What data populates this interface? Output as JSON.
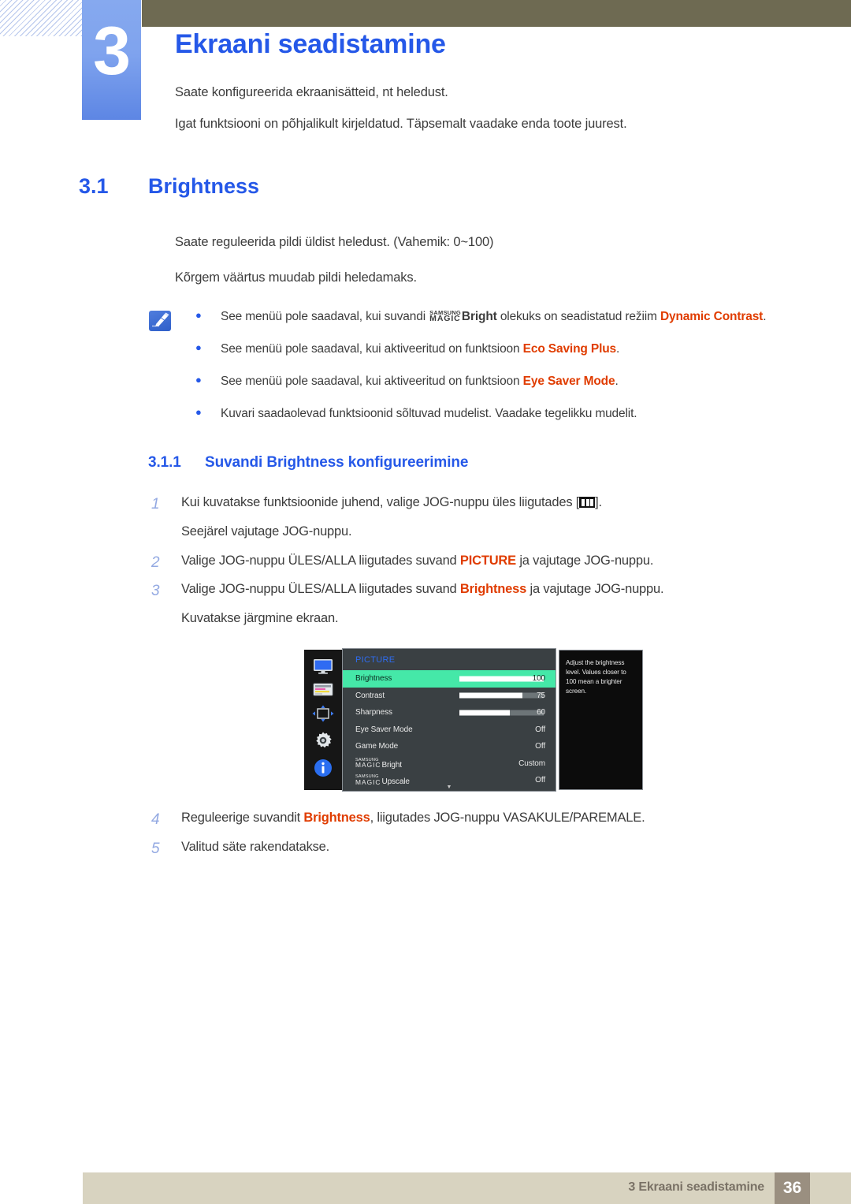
{
  "header": {
    "chapter_number": "3",
    "chapter_title": "Ekraani seadistamine",
    "intro_line_1": "Saate konfigureerida ekraanisätteid, nt heledust.",
    "intro_line_2": "Igat funktsiooni on põhjalikult kirjeldatud. Täpsemalt vaadake enda toote juurest.",
    "accent_color": "#2558e8",
    "band_color": "#6e6a52"
  },
  "section": {
    "number": "3.1",
    "title": "Brightness",
    "paragraph_1": "Saate reguleerida pildi üldist heledust. (Vahemik: 0~100)",
    "paragraph_2": "Kõrgem väärtus muudab pildi heledamaks."
  },
  "notes": {
    "icon": "note-pencil-icon",
    "items": [
      {
        "bullet": "●",
        "prefix": "See menüü pole saadaval, kui suvandi ",
        "magic_small": "SAMSUNG",
        "magic_large": "MAGIC",
        "magic_suffix": "Bright",
        "middle": " olekuks on seadistatud režiim ",
        "highlight": "Dynamic Contrast",
        "suffix": "."
      },
      {
        "bullet": "●",
        "prefix": "See menüü pole saadaval, kui aktiveeritud on funktsioon ",
        "highlight": "Eco Saving Plus",
        "suffix": "."
      },
      {
        "bullet": "●",
        "prefix": "See menüü pole saadaval, kui aktiveeritud on funktsioon ",
        "highlight": "Eye Saver Mode",
        "suffix": "."
      },
      {
        "bullet": "●",
        "prefix": "Kuvari saadaolevad funktsioonid sõltuvad mudelist. Vaadake tegelikku mudelit.",
        "highlight": "",
        "suffix": ""
      }
    ],
    "highlight_color": "#e03c00"
  },
  "subsection": {
    "number": "3.1.1",
    "title": "Suvandi Brightness konfigureerimine"
  },
  "steps": [
    {
      "number": "1",
      "text_before": "Kui kuvatakse funktsioonide juhend, valige JOG-nuppu üles liigutades [",
      "icon": "jog-menu-icon",
      "text_after": "].",
      "sub_text": "Seejärel vajutage JOG-nuppu."
    },
    {
      "number": "2",
      "text_before": "Valige JOG-nuppu ÜLES/ALLA liigutades suvand ",
      "highlight": "PICTURE",
      "text_after": " ja vajutage JOG-nuppu."
    },
    {
      "number": "3",
      "text_before": "Valige JOG-nuppu ÜLES/ALLA liigutades suvand ",
      "highlight": "Brightness",
      "text_after": " ja vajutage JOG-nuppu.",
      "sub_text": "Kuvatakse järgmine ekraan."
    },
    {
      "number": "4",
      "text_before": "Reguleerige suvandit ",
      "highlight": "Brightness",
      "text_after": ", liigutades JOG-nuppu VASAKULE/PAREMALE."
    },
    {
      "number": "5",
      "text_before": "Valitud säte rakendatakse.",
      "highlight": "",
      "text_after": ""
    }
  ],
  "osd": {
    "menu_title": "PICTURE",
    "title_color": "#2e6cf0",
    "highlight_color": "#45e8a8",
    "sidebar_icons": [
      "display-monitor-icon",
      "osd-list-icon",
      "pip-resize-arrows-icon",
      "gear-settings-icon",
      "information-icon"
    ],
    "rows": [
      {
        "label": "Brightness",
        "value": "100",
        "bar": 100,
        "selected": true,
        "magic": false
      },
      {
        "label": "Contrast",
        "value": "75",
        "bar": 75,
        "selected": false,
        "magic": false
      },
      {
        "label": "Sharpness",
        "value": "60",
        "bar": 60,
        "selected": false,
        "magic": false
      },
      {
        "label": "Eye Saver Mode",
        "value": "Off",
        "bar": null,
        "selected": false,
        "magic": false
      },
      {
        "label": "Game Mode",
        "value": "Off",
        "bar": null,
        "selected": false,
        "magic": false
      },
      {
        "label": "Bright",
        "value": "Custom",
        "bar": null,
        "selected": false,
        "magic": true
      },
      {
        "label": "Upscale",
        "value": "Off",
        "bar": null,
        "selected": false,
        "magic": true
      }
    ],
    "magic_small": "SAMSUNG",
    "magic_large": "MAGIC",
    "scroll_chevron": "▼",
    "tooltip": "Adjust the brightness level. Values closer to 100 mean a brighter screen."
  },
  "footer": {
    "text": "3 Ekraani seadistamine",
    "page_number": "36",
    "bar_color": "#d8d3c0",
    "page_box_color": "#9a8f80"
  }
}
